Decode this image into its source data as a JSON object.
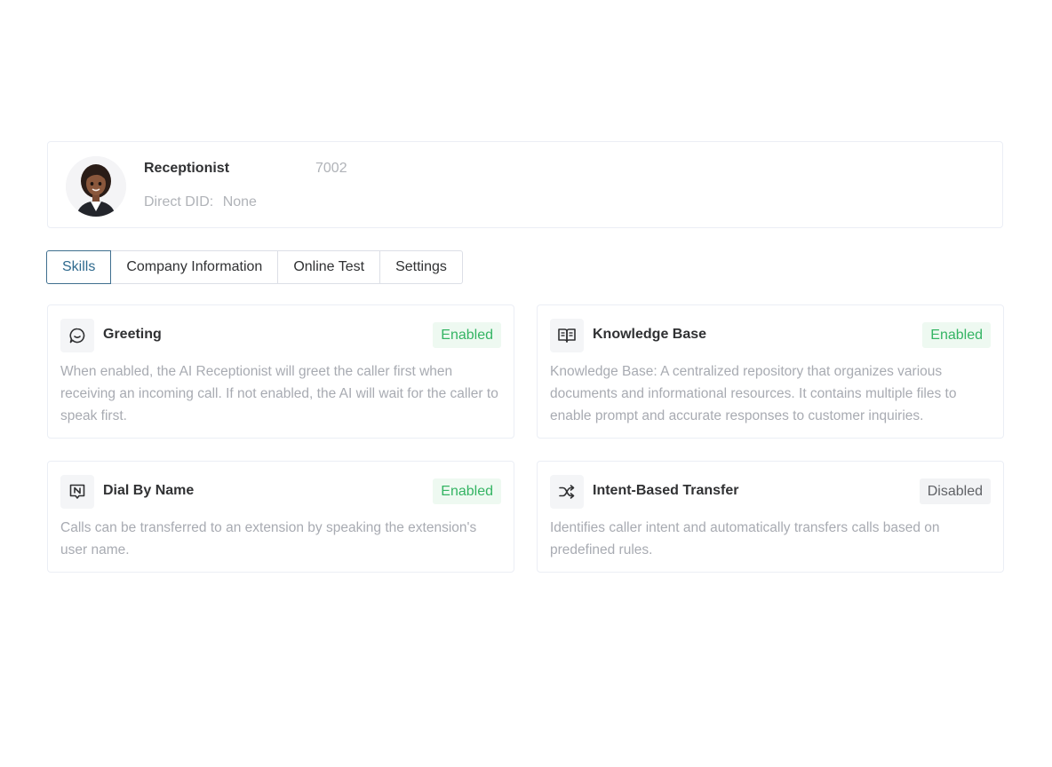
{
  "agent": {
    "name": "Receptionist",
    "extension": "7002",
    "did_label": "Direct DID:",
    "did_value": "None"
  },
  "tabs": [
    {
      "label": "Skills",
      "active": true
    },
    {
      "label": "Company Information",
      "active": false
    },
    {
      "label": "Online Test",
      "active": false
    },
    {
      "label": "Settings",
      "active": false
    }
  ],
  "skills": [
    {
      "title": "Greeting",
      "icon": "chat-bubble-icon",
      "status": "Enabled",
      "description": "When enabled, the AI Receptionist will greet the caller first when receiving an incoming call. If not enabled, the AI will wait for the caller to speak first."
    },
    {
      "title": "Knowledge Base",
      "icon": "open-book-icon",
      "status": "Enabled",
      "description": "Knowledge Base: A centralized repository that organizes various documents and informational resources. It contains multiple files to enable prompt and accurate responses to customer inquiries."
    },
    {
      "title": "Dial By Name",
      "icon": "name-tag-icon",
      "status": "Enabled",
      "description": "Calls can be transferred to an extension by speaking the extension's user name."
    },
    {
      "title": "Intent-Based Transfer",
      "icon": "shuffle-icon",
      "status": "Disabled",
      "description": "Identifies caller intent and automatically transfers calls based on predefined rules."
    }
  ],
  "colors": {
    "enabled_text": "#34b463",
    "enabled_bg": "#eef9f1",
    "disabled_text": "#606266",
    "disabled_bg": "#f2f3f5",
    "active_tab_border": "#3f6f8f"
  }
}
